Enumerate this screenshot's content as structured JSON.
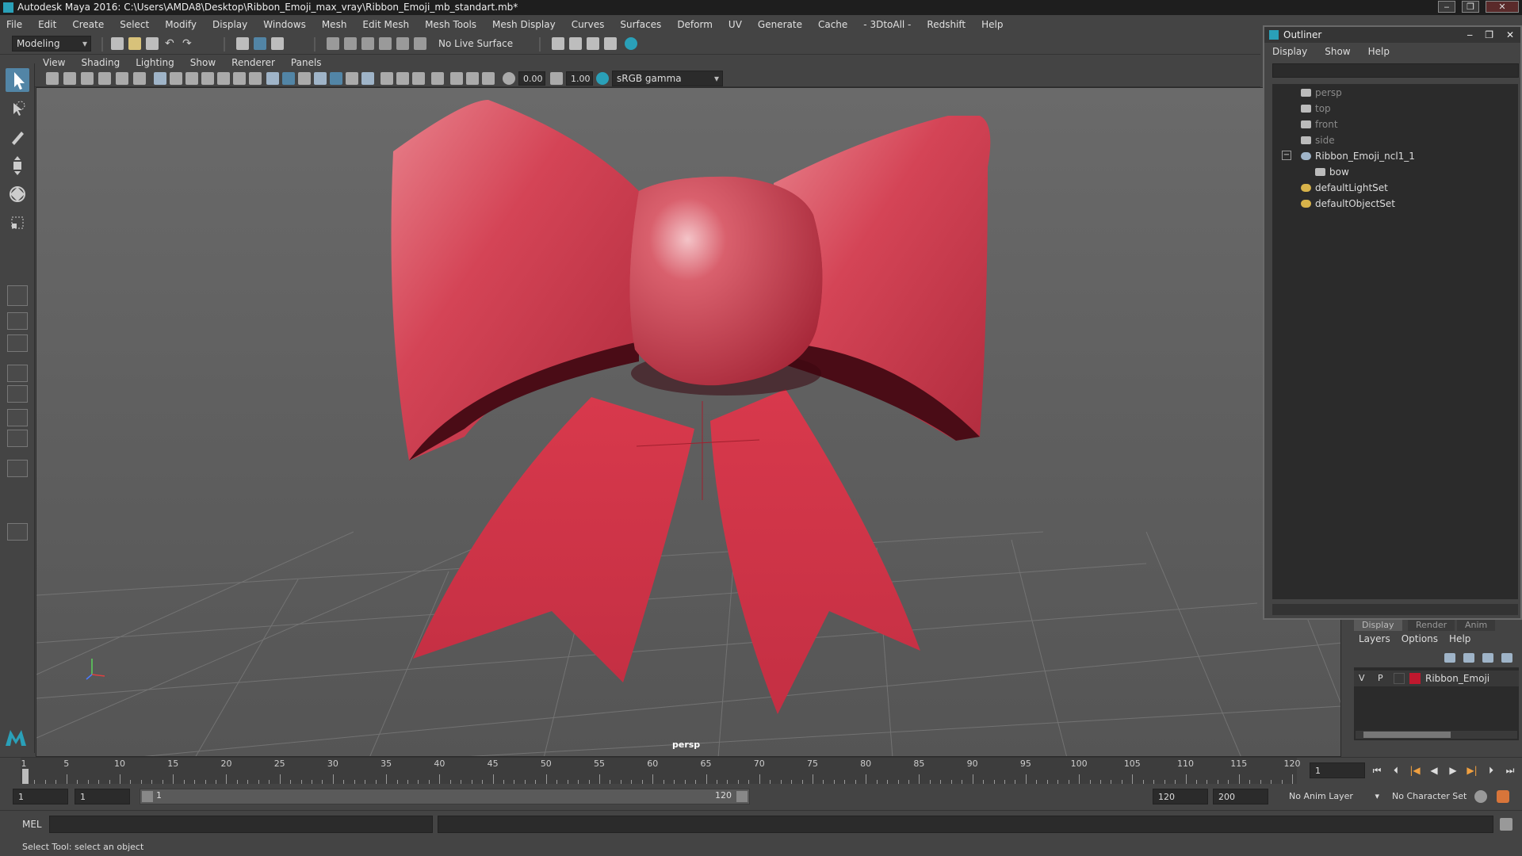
{
  "window": {
    "title": "Autodesk Maya 2016: C:\\Users\\AMDA8\\Desktop\\Ribbon_Emoji_max_vray\\Ribbon_Emoji_mb_standart.mb*"
  },
  "menubar": {
    "items": [
      "File",
      "Edit",
      "Create",
      "Select",
      "Modify",
      "Display",
      "Windows",
      "Mesh",
      "Edit Mesh",
      "Mesh Tools",
      "Mesh Display",
      "Curves",
      "Surfaces",
      "Deform",
      "UV",
      "Generate",
      "Cache",
      "- 3DtoAll -",
      "Redshift",
      "Help"
    ]
  },
  "shelf": {
    "mode": "Modeling",
    "live_surface": "No Live Surface"
  },
  "panel": {
    "menus": [
      "View",
      "Shading",
      "Lighting",
      "Show",
      "Renderer",
      "Panels"
    ],
    "exposure": "0.00",
    "gamma": "1.00",
    "color_space": "sRGB gamma",
    "camera_label": "persp"
  },
  "outliner": {
    "title": "Outliner",
    "menus": [
      "Display",
      "Show",
      "Help"
    ],
    "items": [
      {
        "label": "persp",
        "type": "camera",
        "dim": true
      },
      {
        "label": "top",
        "type": "camera",
        "dim": true
      },
      {
        "label": "front",
        "type": "camera",
        "dim": true
      },
      {
        "label": "side",
        "type": "camera",
        "dim": true
      },
      {
        "label": "Ribbon_Emoji_ncl1_1",
        "type": "group",
        "dim": false
      },
      {
        "label": "bow",
        "type": "mesh",
        "dim": false
      },
      {
        "label": "defaultLightSet",
        "type": "set",
        "dim": false
      },
      {
        "label": "defaultObjectSet",
        "type": "set",
        "dim": false
      }
    ]
  },
  "layers": {
    "tabs": [
      "Display",
      "Render",
      "Anim"
    ],
    "menus": [
      "Layers",
      "Options",
      "Help"
    ],
    "row": {
      "v": "V",
      "p": "P",
      "name": "Ribbon_Emoji",
      "color": "#c0182e"
    }
  },
  "timeline": {
    "labels": [
      "1",
      "5",
      "10",
      "15",
      "20",
      "25",
      "30",
      "35",
      "40",
      "45",
      "50",
      "55",
      "60",
      "65",
      "70",
      "75",
      "80",
      "85",
      "90",
      "95",
      "100",
      "105",
      "110",
      "115",
      "120"
    ],
    "current_frame": "1"
  },
  "range": {
    "start": "1",
    "playback_start": "1",
    "slider_start": "1",
    "slider_end": "120",
    "playback_end": "120",
    "end": "200",
    "anim_layer": "No Anim Layer",
    "character_set": "No Character Set"
  },
  "cmdline": {
    "label": "MEL"
  },
  "status": {
    "text": "Select Tool: select an object"
  },
  "colors": {
    "accent": "#5285a6",
    "bow": "#cf3548"
  }
}
